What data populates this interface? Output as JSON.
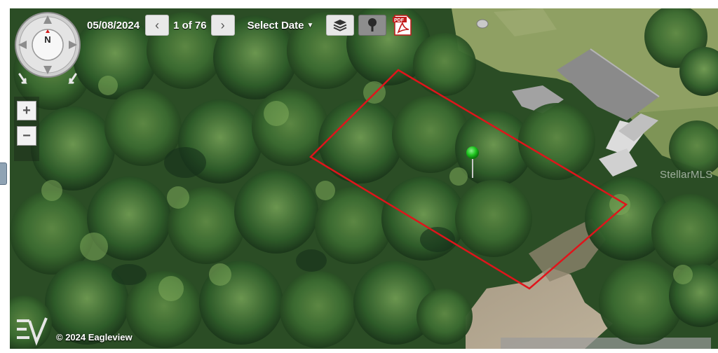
{
  "toolbar": {
    "date": "05/08/2024",
    "page_count": "1 of 76",
    "select_date_label": "Select Date",
    "prev_label": "‹",
    "next_label": "›"
  },
  "compass": {
    "north_label": "N"
  },
  "zoom": {
    "in_label": "+",
    "out_label": "−"
  },
  "watermark": "StellarMLS",
  "footer": {
    "copyright": "© 2024 Eagleview"
  },
  "colors": {
    "parcel_outline": "#e0141b",
    "pin": "#1ec41e",
    "foliage": "#2e5a27",
    "lawn": "#8d9f61",
    "roof": "#7c7c7c"
  },
  "icons": {
    "prev": "chevron-left-icon",
    "next": "chevron-right-icon",
    "layers": "layers-icon",
    "location": "keyhole-pin-icon",
    "pdf": "pdf-icon",
    "compass": "compass-icon",
    "logo": "eagleview-logo-icon",
    "marker": "map-pin-icon"
  }
}
